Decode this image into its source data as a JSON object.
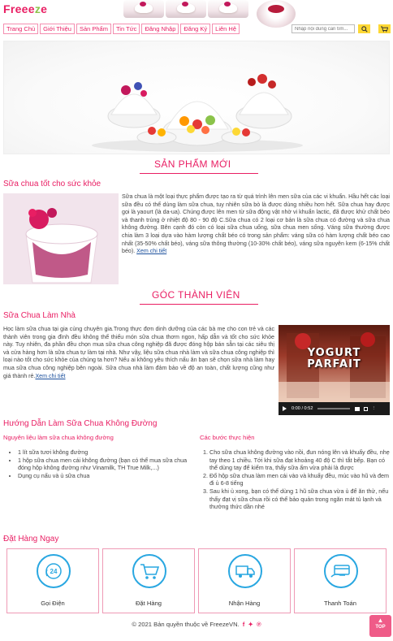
{
  "brand": {
    "logo_main": "Freee",
    "logo_accent": "z",
    "logo_tail": "e"
  },
  "nav": {
    "items": [
      "Trang Chủ",
      "Giới Thiệu",
      "Sản Phẩm",
      "Tin Tức",
      "Đăng Nhập",
      "Đăng Ký",
      "Liên Hệ"
    ]
  },
  "search": {
    "placeholder": "Nhập nội dung cần tìm..."
  },
  "sections": {
    "new_products": "SẢN PHẨM MỚI",
    "member_corner": "GÓC THÀNH VIÊN"
  },
  "article1": {
    "title": "Sữa chua tốt cho sức khỏe",
    "body": "Sữa chua là một loại thực phẩm được tạo ra từ quá trình lên men sữa của các vi khuẩn. Hầu hết các loại sữa đều có thể dùng làm sữa chua, tuy nhiên sữa bò là được dùng nhiều hơn hết. Sữa chua hay được gọi là yaourt (là da-ua). Chúng được lên men từ sữa động vật nhờ vi khuẩn lactic, đã được khử chất béo và thanh trùng ở nhiệt độ 80 - 90 độ C.Sữa chua có 2 loại cơ bản là sữa chua có đường và sữa chua không đường. Bên cạnh đó còn có loại sữa chua uống, sữa chua men sống. Váng sữa thường được chia làm 3 loại dựa vào hàm lượng chất béo có trong sản phẩm: váng sữa có hàm lượng chất béo cao nhất (35-50% chất béo), váng sữa thông thường (10-30% chất béo), váng sữa nguyên kem (6-15% chất béo).",
    "more": "Xem chi tiết"
  },
  "article2": {
    "title": "Sữa Chua Làm Nhà",
    "body": "Học làm sữa chua tại gia cùng chuyên gia.Trong thực đơn dinh dưỡng của các bà mẹ cho con trẻ và các thành viên trong gia đình đều không thể thiếu món sữa chua thơm ngon, hấp dẫn và tốt cho sức khỏe này. Tuy nhiên, đa phần đều chọn mua sữa chua công nghiệp đã được đóng hộp bán sẵn tại các siêu thị và cửa hàng hơn là sữa chua tự làm tại nhà. Như vậy, liệu sữa chua nhà làm và sữa chua công nghiệp thì loại nào tốt cho sức khỏe của chúng ta hơn? Nếu ai không yêu thích nấu ăn bạn sẽ chọn sữa nhà làm hay mua sữa chua công nghiệp bên ngoài. Sữa chua nhà làm đảm bảo về độ an toàn, chất lượng cũng như giá thành rẻ.",
    "more": "Xem chi tiết"
  },
  "video": {
    "overlay_line1": "YOGURT",
    "overlay_line2": "PARFAIT",
    "time": "0:00 / 0:52"
  },
  "recipe": {
    "title": "Hướng Dẫn Làm Sữa Chua Không Đường",
    "ingredients_head": "Nguyên liệu làm sữa chua không đường",
    "ingredients": [
      "1 lít sữa tươi không đường",
      "1 hộp sữa chua men cái không đường (bạn có thể mua sữa chua đóng hộp không đường như Vinamilk, TH True Milk,...)",
      "Dụng cụ nấu và ủ sữa chua"
    ],
    "steps_head": "Các bước thực hiện",
    "steps": [
      "Cho sữa chua không đường vào nồi, đun nóng lên và khuấy đều, nhẹ tay theo 1 chiều. Tới khi sữa đạt khoảng 40 độ C thì tắt bếp. Bạn có thể dùng tay để kiểm tra, thấy sữa ấm vừa phải là được",
      "Đổ hộp sữa chua làm men cái vào và khuấy đều, múc vào hũ và đem đi ủ 6-8 tiếng",
      "Sau khi ủ xong, bạn có thể dùng 1 hũ sữa chua vừa ủ để ăn thử, nếu thấy đạt vị sữa chua rồi có thể bảo quản trong ngăn mát tủ lạnh và thưởng thức dần nhé"
    ]
  },
  "order": {
    "title": "Đặt Hàng Ngay",
    "items": [
      {
        "label": "Gọi Điện",
        "icon": "phone-24-icon"
      },
      {
        "label": "Đặt Hàng",
        "icon": "shopping-cart-icon"
      },
      {
        "label": "Nhận Hàng",
        "icon": "delivery-truck-icon"
      },
      {
        "label": "Thanh Toán",
        "icon": "payment-card-icon"
      }
    ],
    "phone_badge": "24"
  },
  "footer": {
    "copyright": "© 2021 Bản quyền thuộc về FreezeVN."
  },
  "top_button": "TOP",
  "colors": {
    "accent": "#e91e63",
    "icon_blue": "#29a7e1",
    "button_yellow": "#fdd835"
  }
}
